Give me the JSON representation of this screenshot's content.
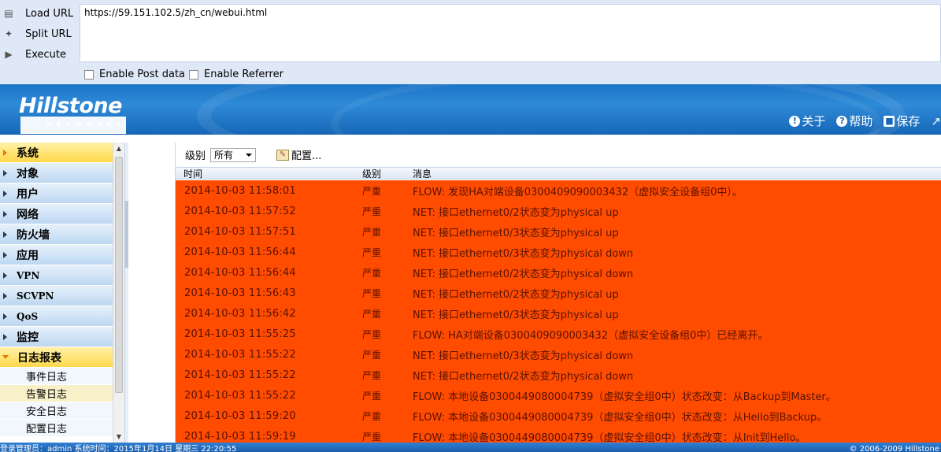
{
  "toolbar": {
    "load_url": "Load URL",
    "split_url": "Split URL",
    "execute": "Execute",
    "url_value": "https://59.151.102.5/zh_cn/webui.html",
    "enable_post": "Enable Post data",
    "enable_referrer": "Enable Referrer"
  },
  "header": {
    "logo_main": "Hillstone",
    "logo_sub": "NETWORKS",
    "about": "关于",
    "help": "帮助",
    "save": "保存"
  },
  "sidebar": {
    "items": [
      {
        "label": "系统"
      },
      {
        "label": "对象"
      },
      {
        "label": "用户"
      },
      {
        "label": "网络"
      },
      {
        "label": "防火墙"
      },
      {
        "label": "应用"
      },
      {
        "label": "VPN"
      },
      {
        "label": "SCVPN"
      },
      {
        "label": "QoS"
      },
      {
        "label": "监控"
      },
      {
        "label": "日志报表"
      }
    ],
    "subitems": [
      {
        "label": "事件日志"
      },
      {
        "label": "告警日志"
      },
      {
        "label": "安全日志"
      },
      {
        "label": "配置日志"
      }
    ]
  },
  "main": {
    "level_label": "级别",
    "level_value": "所有",
    "config_label": "配置...",
    "columns": [
      "时间",
      "级别",
      "消息"
    ],
    "rows": [
      {
        "time": "2014-10-03 11:58:01",
        "level": "严重",
        "msg": "FLOW: 发现HA对端设备0300409090003432（虚拟安全设备组0中）。"
      },
      {
        "time": "2014-10-03 11:57:52",
        "level": "严重",
        "msg": "NET: 接口ethernet0/2状态变为physical up"
      },
      {
        "time": "2014-10-03 11:57:51",
        "level": "严重",
        "msg": "NET: 接口ethernet0/3状态变为physical up"
      },
      {
        "time": "2014-10-03 11:56:44",
        "level": "严重",
        "msg": "NET: 接口ethernet0/3状态变为physical down"
      },
      {
        "time": "2014-10-03 11:56:44",
        "level": "严重",
        "msg": "NET: 接口ethernet0/2状态变为physical down"
      },
      {
        "time": "2014-10-03 11:56:43",
        "level": "严重",
        "msg": "NET: 接口ethernet0/2状态变为physical up"
      },
      {
        "time": "2014-10-03 11:56:42",
        "level": "严重",
        "msg": "NET: 接口ethernet0/3状态变为physical up"
      },
      {
        "time": "2014-10-03 11:55:25",
        "level": "严重",
        "msg": "FLOW: HA对端设备0300409090003432（虚拟安全设备组0中）已经离开。"
      },
      {
        "time": "2014-10-03 11:55:22",
        "level": "严重",
        "msg": "NET: 接口ethernet0/3状态变为physical down"
      },
      {
        "time": "2014-10-03 11:55:22",
        "level": "严重",
        "msg": "NET: 接口ethernet0/2状态变为physical down"
      },
      {
        "time": "2014-10-03 11:55:22",
        "level": "严重",
        "msg": "FLOW: 本地设备0300449080004739（虚拟安全组0中）状态改变：从Backup到Master。"
      },
      {
        "time": "2014-10-03 11:59:20",
        "level": "严重",
        "msg": "FLOW: 本地设备0300449080004739（虚拟安全组0中）状态改变：从Hello到Backup。"
      },
      {
        "time": "2014-10-03 11:59:19",
        "level": "严重",
        "msg": "FLOW: 本地设备0300449080004739（虚拟安全组0中）状态改变：从Init到Hello。"
      }
    ]
  },
  "status": {
    "left": "登录管理员：admin  系统时间：2015年1月14日 星期三 22:20:55",
    "right": "© 2006-2009 Hillstone"
  },
  "colors": {
    "alarm_row": "#ff4c00",
    "banner": "#1c74c6",
    "active_nav": "#ffd84a"
  }
}
